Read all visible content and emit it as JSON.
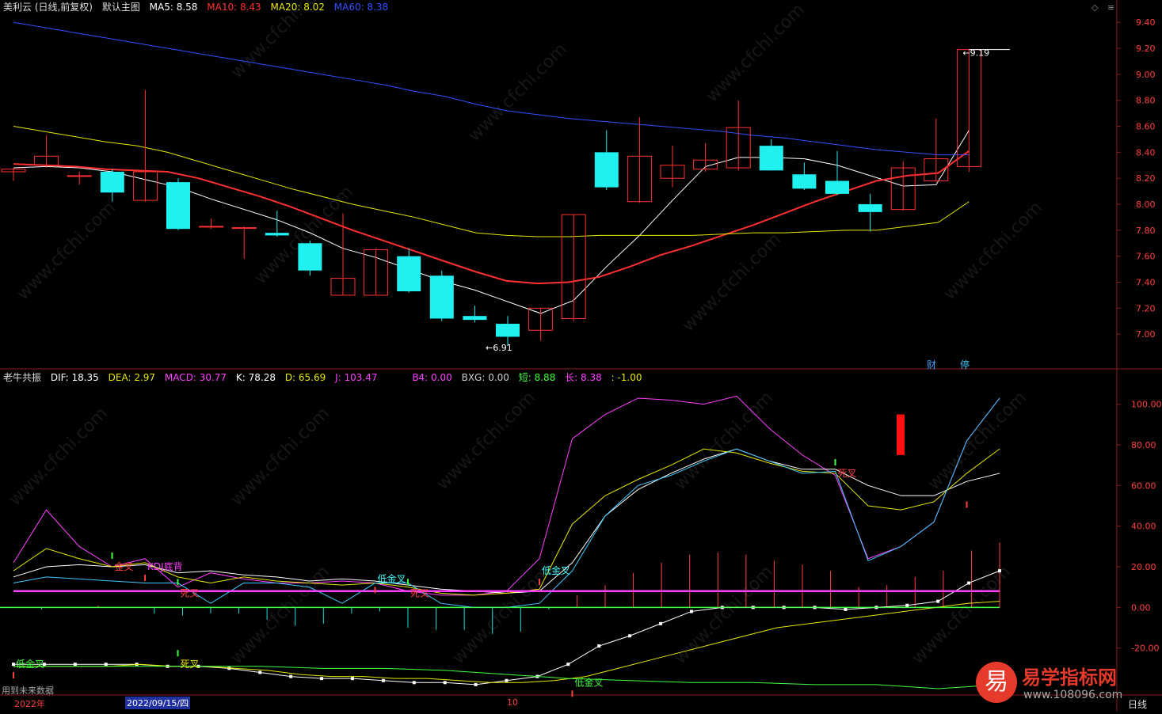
{
  "main_header": {
    "stock": "美利云 (日线,前复权)",
    "template": "默认主图",
    "ma": [
      {
        "label": "MA5: 8.58",
        "color": "#ffffff"
      },
      {
        "label": "MA10: 8.43",
        "color": "#ff3030"
      },
      {
        "label": "MA20: 8.02",
        "color": "#e6e600"
      },
      {
        "label": "MA60: 8.38",
        "color": "#3050ff"
      }
    ]
  },
  "sub_header": {
    "name": "老牛共振",
    "items": [
      {
        "label": "DIF: 18.35",
        "color": "#ffffff"
      },
      {
        "label": "DEA: 2.97",
        "color": "#e6e600"
      },
      {
        "label": "MACD: 30.77",
        "color": "#ff40ff"
      },
      {
        "label": "K: 78.28",
        "color": "#ffffff"
      },
      {
        "label": "D: 65.69",
        "color": "#e6e600"
      },
      {
        "label": "J: 103.47",
        "color": "#ff40ff"
      },
      {
        "label": "B4: 0.00",
        "color": "#ff40ff"
      },
      {
        "label": "BXG: 0.00",
        "color": "#cccccc"
      },
      {
        "label": "短: 8.88",
        "color": "#40ff40"
      },
      {
        "label": "长: 8.38",
        "color": "#ff40ff"
      },
      {
        "label": ": -1.00",
        "color": "#e6e600"
      }
    ]
  },
  "bottom": {
    "note": "用到未来数据",
    "year": "2022年",
    "date": "2022/09/15/四",
    "month": "10",
    "period": "日线"
  },
  "badges": {
    "cai": "财",
    "ting": "停"
  },
  "logo": {
    "glyph": "易",
    "name": "易学指标网",
    "url": "www.108096.com"
  },
  "watermark": "www.cfchi.com",
  "chart_data": [
    {
      "type": "candlestick",
      "title": "美利云 (日线,前复权)",
      "ylim": [
        6.8,
        9.45
      ],
      "yticks": [
        7.0,
        7.2,
        7.4,
        7.6,
        7.8,
        8.0,
        8.2,
        8.4,
        8.6,
        8.8,
        9.0,
        9.2,
        9.4
      ],
      "ytick_labels": [
        "7.00",
        "7.20",
        "7.40",
        "7.60",
        "7.80",
        "8.00",
        "8.20",
        "8.40",
        "8.60",
        "8.80",
        "9.00",
        "9.20",
        "9.40"
      ],
      "candles": [
        {
          "o": 8.25,
          "h": 8.28,
          "l": 8.18,
          "c": 8.27
        },
        {
          "o": 8.3,
          "h": 8.53,
          "l": 8.28,
          "c": 8.37
        },
        {
          "o": 8.22,
          "h": 8.25,
          "l": 8.15,
          "c": 8.22
        },
        {
          "o": 8.25,
          "h": 8.27,
          "l": 8.02,
          "c": 8.09
        },
        {
          "o": 8.03,
          "h": 8.88,
          "l": 8.02,
          "c": 8.25
        },
        {
          "o": 8.17,
          "h": 8.2,
          "l": 7.8,
          "c": 7.81
        },
        {
          "o": 7.83,
          "h": 7.89,
          "l": 7.81,
          "c": 7.83
        },
        {
          "o": 7.82,
          "h": 7.83,
          "l": 7.58,
          "c": 7.82
        },
        {
          "o": 7.78,
          "h": 7.95,
          "l": 7.75,
          "c": 7.76
        },
        {
          "o": 7.7,
          "h": 7.72,
          "l": 7.45,
          "c": 7.49
        },
        {
          "o": 7.3,
          "h": 7.93,
          "l": 7.3,
          "c": 7.43
        },
        {
          "o": 7.3,
          "h": 7.66,
          "l": 7.3,
          "c": 7.65
        },
        {
          "o": 7.6,
          "h": 7.66,
          "l": 7.32,
          "c": 7.33
        },
        {
          "o": 7.45,
          "h": 7.49,
          "l": 7.1,
          "c": 7.12
        },
        {
          "o": 7.14,
          "h": 7.22,
          "l": 7.09,
          "c": 7.11
        },
        {
          "o": 7.08,
          "h": 7.14,
          "l": 6.91,
          "c": 6.98
        },
        {
          "o": 7.03,
          "h": 7.2,
          "l": 6.95,
          "c": 7.2
        },
        {
          "o": 7.12,
          "h": 7.92,
          "l": 7.1,
          "c": 7.92
        },
        {
          "o": 8.4,
          "h": 8.57,
          "l": 8.11,
          "c": 8.13
        },
        {
          "o": 8.02,
          "h": 8.67,
          "l": 8.01,
          "c": 8.37
        },
        {
          "o": 8.2,
          "h": 8.45,
          "l": 8.13,
          "c": 8.3
        },
        {
          "o": 8.27,
          "h": 8.47,
          "l": 8.25,
          "c": 8.34
        },
        {
          "o": 8.28,
          "h": 8.8,
          "l": 8.26,
          "c": 8.59
        },
        {
          "o": 8.45,
          "h": 8.5,
          "l": 8.26,
          "c": 8.26
        },
        {
          "o": 8.23,
          "h": 8.32,
          "l": 8.11,
          "c": 8.12
        },
        {
          "o": 8.18,
          "h": 8.41,
          "l": 8.07,
          "c": 8.08
        },
        {
          "o": 8.0,
          "h": 8.08,
          "l": 7.79,
          "c": 7.94
        },
        {
          "o": 7.96,
          "h": 8.33,
          "l": 7.95,
          "c": 8.28
        },
        {
          "o": 8.18,
          "h": 8.66,
          "l": 8.17,
          "c": 8.35
        },
        {
          "o": 8.29,
          "h": 9.19,
          "l": 8.25,
          "c": 9.19
        }
      ],
      "annotations": [
        {
          "label": "6.91",
          "value": 6.91,
          "index": 15
        },
        {
          "label": "9.19",
          "value": 9.19,
          "index": 29
        }
      ],
      "series": [
        {
          "name": "MA5",
          "color": "#ffffff",
          "values": [
            8.28,
            8.29,
            8.28,
            8.25,
            8.19,
            8.13,
            8.04,
            7.96,
            7.88,
            7.78,
            7.66,
            7.59,
            7.5,
            7.41,
            7.34,
            7.25,
            7.16,
            7.26,
            7.52,
            7.76,
            8.03,
            8.29,
            8.36,
            8.36,
            8.35,
            8.3,
            8.22,
            8.14,
            8.15,
            8.57
          ]
        },
        {
          "name": "MA10",
          "color": "#ff3030",
          "values": [
            8.31,
            8.3,
            8.29,
            8.27,
            8.26,
            8.25,
            8.2,
            8.13,
            8.06,
            7.98,
            7.89,
            7.8,
            7.72,
            7.64,
            7.56,
            7.48,
            7.41,
            7.39,
            7.4,
            7.44,
            7.52,
            7.61,
            7.68,
            7.76,
            7.84,
            7.93,
            8.02,
            8.1,
            8.18,
            8.22,
            8.24,
            8.41
          ]
        },
        {
          "name": "MA20",
          "color": "#e6e600",
          "values": [
            8.6,
            8.56,
            8.52,
            8.48,
            8.45,
            8.4,
            8.33,
            8.26,
            8.19,
            8.12,
            8.06,
            8.0,
            7.95,
            7.9,
            7.84,
            7.78,
            7.76,
            7.75,
            7.75,
            7.76,
            7.76,
            7.76,
            7.76,
            7.77,
            7.78,
            7.78,
            7.79,
            7.8,
            7.8,
            7.83,
            7.86,
            8.02
          ]
        },
        {
          "name": "MA60",
          "color": "#3050ff",
          "values": [
            9.4,
            9.36,
            9.32,
            9.28,
            9.24,
            9.2,
            9.16,
            9.12,
            9.08,
            9.04,
            9.0,
            8.96,
            8.92,
            8.87,
            8.83,
            8.77,
            8.72,
            8.69,
            8.66,
            8.64,
            8.62,
            8.6,
            8.58,
            8.56,
            8.53,
            8.51,
            8.48,
            8.45,
            8.42,
            8.4,
            8.38,
            8.38
          ]
        }
      ]
    },
    {
      "type": "line",
      "title": "老牛共振",
      "ylim": [
        -40,
        110
      ],
      "yticks": [
        -20,
        0,
        20,
        40,
        60,
        80,
        100
      ],
      "ytick_labels": [
        "-20.00",
        "0.00",
        "20.00",
        "40.00",
        "60.00",
        "80.00",
        "100.00"
      ],
      "macd_bars": [
        0,
        -1,
        0,
        1,
        0,
        -3,
        -4,
        -3,
        -3,
        -6,
        -9,
        -8,
        -3,
        -2,
        -10,
        -11,
        -11,
        -13,
        -12,
        -1,
        6,
        11,
        17,
        22,
        26,
        27,
        26,
        23,
        21,
        18,
        10,
        11,
        15,
        18,
        28,
        32
      ],
      "markers": [
        {
          "label": "低金叉",
          "index": 0,
          "value": -28,
          "dir": "up",
          "color": "#40ff40"
        },
        {
          "label": "死叉",
          "index": 5,
          "value": -28,
          "dir": "down",
          "color": "#e6e600"
        },
        {
          "label": "金叉",
          "index": 3,
          "value": 20,
          "dir": "down",
          "color": "#ff4040"
        },
        {
          "label": "KDJ底背",
          "index": 4,
          "value": 20,
          "dir": "up",
          "color": "#ff40ff"
        },
        {
          "label": "死叉",
          "index": 5,
          "value": 7,
          "dir": "down",
          "color": "#ff4040"
        },
        {
          "label": "低金叉",
          "index": 11,
          "value": 14,
          "dir": "up",
          "color": "#40ffff"
        },
        {
          "label": "死叉",
          "index": 12,
          "value": 7,
          "dir": "down",
          "color": "#ff4040"
        },
        {
          "label": "低金叉",
          "index": 16,
          "value": 18,
          "dir": "up",
          "color": "#40ffff"
        },
        {
          "label": "低金叉",
          "index": 17,
          "value": -37,
          "dir": "up",
          "color": "#40ff40"
        },
        {
          "label": "死叉",
          "index": 25,
          "value": 66,
          "dir": "down",
          "color": "#ff4040"
        },
        {
          "label": "",
          "index": 29,
          "value": 56,
          "dir": "up",
          "color": "#ff4040"
        }
      ],
      "series": [
        {
          "name": "J",
          "color": "#ff40ff",
          "values": [
            22,
            48,
            30,
            20,
            24,
            10,
            17,
            14,
            12,
            12,
            13,
            12,
            8,
            6,
            6,
            8,
            24,
            83,
            95,
            103,
            102,
            100,
            104,
            88,
            75,
            65,
            24,
            30,
            42,
            82,
            103
          ]
        },
        {
          "name": "K",
          "color": "#ffffff",
          "values": [
            15,
            20,
            21,
            20,
            21,
            17,
            18,
            16,
            15,
            13,
            14,
            13,
            11,
            9,
            8,
            7,
            8,
            22,
            45,
            58,
            66,
            73,
            78,
            72,
            68,
            68,
            60,
            55,
            55,
            62,
            66
          ]
        },
        {
          "name": "D",
          "color": "#e6e600",
          "values": [
            18,
            29,
            24,
            20,
            22,
            15,
            12,
            15,
            13,
            12,
            11,
            12,
            10,
            7,
            6,
            7,
            9,
            41,
            55,
            63,
            70,
            78,
            76,
            71,
            67,
            66,
            50,
            48,
            52,
            66,
            78
          ]
        },
        {
          "name": "BB",
          "color": "#40c8ff",
          "values": [
            12,
            15,
            14,
            13,
            12,
            12,
            2,
            12,
            12,
            10,
            2,
            12,
            12,
            2,
            0,
            0,
            2,
            18,
            45,
            60,
            65,
            72,
            78,
            72,
            66,
            67,
            23,
            30,
            42,
            82,
            103
          ]
        },
        {
          "name": "DIF",
          "color": "#ffffff",
          "values": [
            -28,
            -28,
            -28,
            -28,
            -28,
            -29,
            -29,
            -30,
            -32,
            -34,
            -35,
            -35,
            -36,
            -37,
            -37,
            -38,
            -36,
            -34,
            -28,
            -19,
            -14,
            -8,
            -2,
            0,
            0,
            0,
            0,
            -1,
            0,
            1,
            3,
            12,
            18
          ]
        },
        {
          "name": "DEA",
          "color": "#e6e600",
          "values": [
            -29,
            -29,
            -29,
            -29,
            -28,
            -29,
            -29,
            -30,
            -31,
            -33,
            -34,
            -34,
            -35,
            -35,
            -36,
            -37,
            -37,
            -36,
            -34,
            -30,
            -26,
            -22,
            -18,
            -14,
            -10,
            -8,
            -6,
            -4,
            -2,
            0,
            2,
            3
          ]
        },
        {
          "name": "短",
          "color": "#40ff40",
          "values": [
            -29,
            -29,
            -29,
            -29,
            -29,
            -30,
            -30,
            -31,
            -33,
            -35,
            -36,
            -37,
            -37,
            -38,
            -38,
            -40,
            -38
          ]
        },
        {
          "name": "长",
          "color": "#ff40ff",
          "values": [
            8,
            8,
            8,
            8,
            8,
            8,
            8,
            8,
            8,
            8,
            8,
            8,
            8,
            8,
            8,
            8,
            8,
            8,
            8,
            8,
            8,
            8,
            8,
            8,
            8,
            8,
            8,
            8,
            8,
            8,
            8,
            8
          ]
        },
        {
          "name": "",
          "color": "#40ff40",
          "values": [
            0,
            0,
            0,
            0,
            0,
            0,
            0,
            0,
            0,
            0,
            0,
            0,
            0,
            0,
            0,
            0,
            0,
            0,
            0,
            0,
            0,
            0,
            0,
            0,
            0,
            0,
            0,
            0,
            0,
            0,
            0,
            0
          ]
        }
      ]
    }
  ]
}
